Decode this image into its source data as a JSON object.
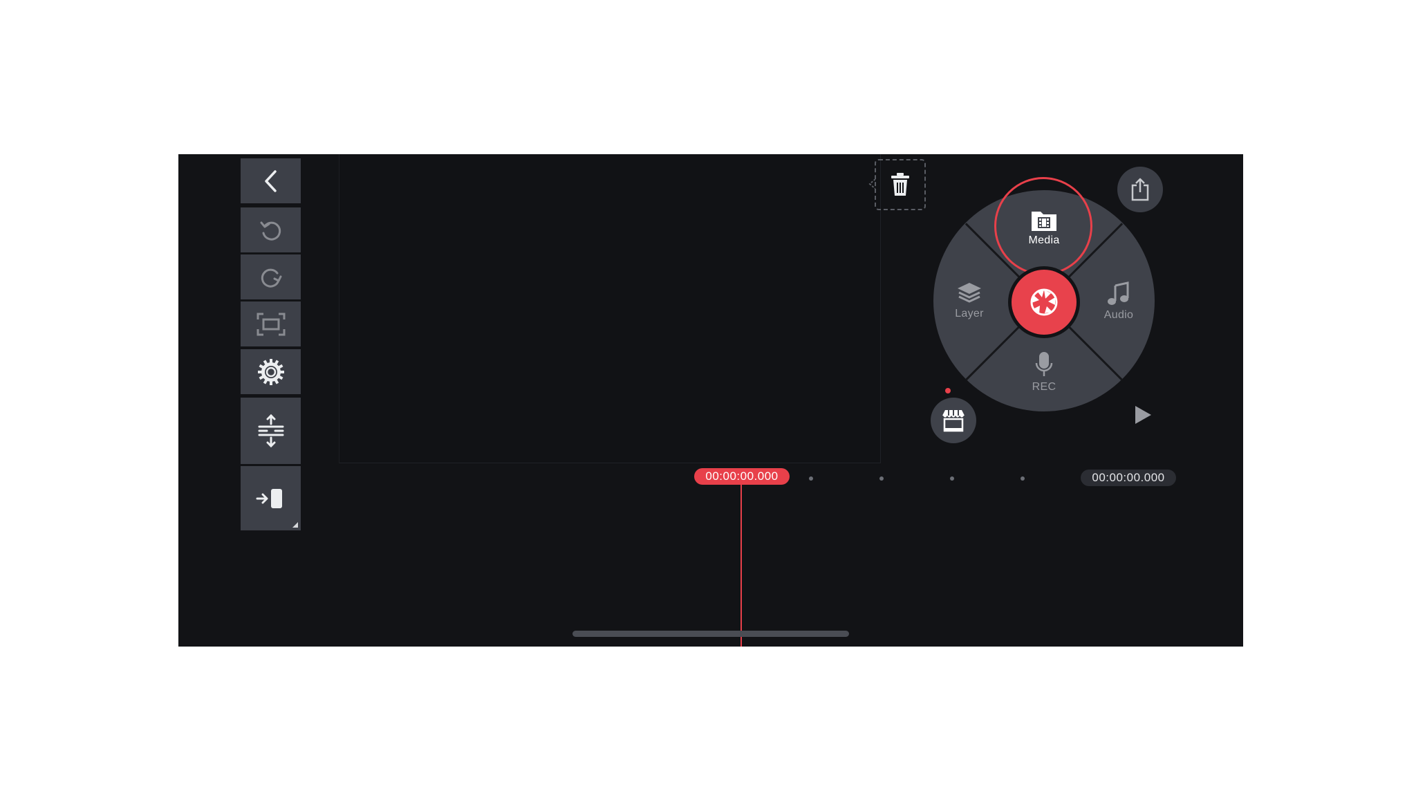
{
  "radial_menu": {
    "media_label": "Media",
    "layer_label": "Layer",
    "audio_label": "Audio",
    "rec_label": "REC"
  },
  "timeline": {
    "playhead_time": "00:00:00.000",
    "total_time": "00:00:00.000"
  },
  "toolbar": {
    "items": [
      "back",
      "undo",
      "redo",
      "fullscreen",
      "settings",
      "track-adjust",
      "export-clip"
    ]
  },
  "colors": {
    "accent": "#e8404a",
    "background": "#121316",
    "panel": "#3d4048"
  },
  "icons": {
    "back": "chevron-left-icon",
    "undo": "undo-icon",
    "redo": "redo-icon",
    "fullscreen": "fullscreen-icon",
    "settings": "gear-icon",
    "track_adjust": "track-adjust-icon",
    "clip_insert": "clip-insert-icon",
    "trash": "trash-icon",
    "share": "share-icon",
    "media": "media-folder-icon",
    "layer": "layers-icon",
    "audio": "music-note-icon",
    "rec": "microphone-icon",
    "capture": "camera-shutter-icon",
    "store": "store-icon",
    "play": "play-icon"
  }
}
